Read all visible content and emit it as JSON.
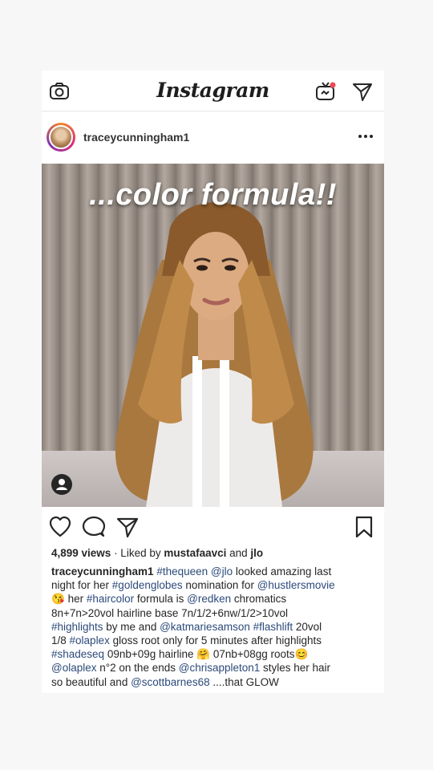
{
  "app": {
    "name": "Instagram"
  },
  "header": {
    "logo": "Instagram",
    "left_icon": "camera-icon",
    "right_icons": [
      "igtv-icon",
      "direct-message-icon"
    ]
  },
  "post": {
    "username": "traceycunningham1",
    "more_icon": "more-options-icon",
    "overlay_text": "...color formula!!",
    "tag_icon": "user-tag-icon",
    "actions": [
      "heart-icon",
      "comment-icon",
      "share-icon",
      "bookmark-icon"
    ],
    "views": "4,899 views",
    "liked_by_prefix": " · Liked by ",
    "liked_by_user": "mustafaavci",
    "liked_by_and": " and ",
    "liked_by_user2": "jlo",
    "caption": {
      "user": "traceycunningham1",
      "l1_a": "#thequeen",
      "l1_b": "@jlo",
      "l1_c": " looked amazing last",
      "l2_a": "night for her ",
      "l2_b": "#goldenglobes",
      "l2_c": " nomination for ",
      "l2_d": "@hustlersmovie",
      "l3_emoji": "😘",
      "l3_a": " her ",
      "l3_b": "#haircolor",
      "l3_c": " formula is ",
      "l3_d": "@redken",
      "l3_e": " chromatics",
      "l4": "8n+7n>20vol hairline base 7n/1/2+6nw/1/2>10vol",
      "l5_a": "#highlights",
      "l5_b": " by me and ",
      "l5_c": "@katmariesamson",
      "l5_d": " ",
      "l5_e": "#flashlift",
      "l5_f": " 20vol",
      "l6_a": "1/8 ",
      "l6_b": "#olaplex",
      "l6_c": "  gloss root only for 5 minutes after highlights",
      "l7_a": "#shadeseq",
      "l7_b": " 09nb+09g hairline ",
      "l7_emoji1": "🤗",
      "l7_c": " 07nb+08gg roots",
      "l7_emoji2": "😊",
      "l8_a": "@olaplex",
      "l8_b": " n°2 on the ends  ",
      "l8_c": "@chrisappleton1",
      "l8_d": " styles her hair",
      "l9_a": "so beautiful and ",
      "l9_b": "@scottbarnes68",
      "l9_c": " ....that GLOW"
    }
  },
  "colors": {
    "link": "#2c4a7a",
    "text": "#262626",
    "background": "#f7f7f8"
  }
}
